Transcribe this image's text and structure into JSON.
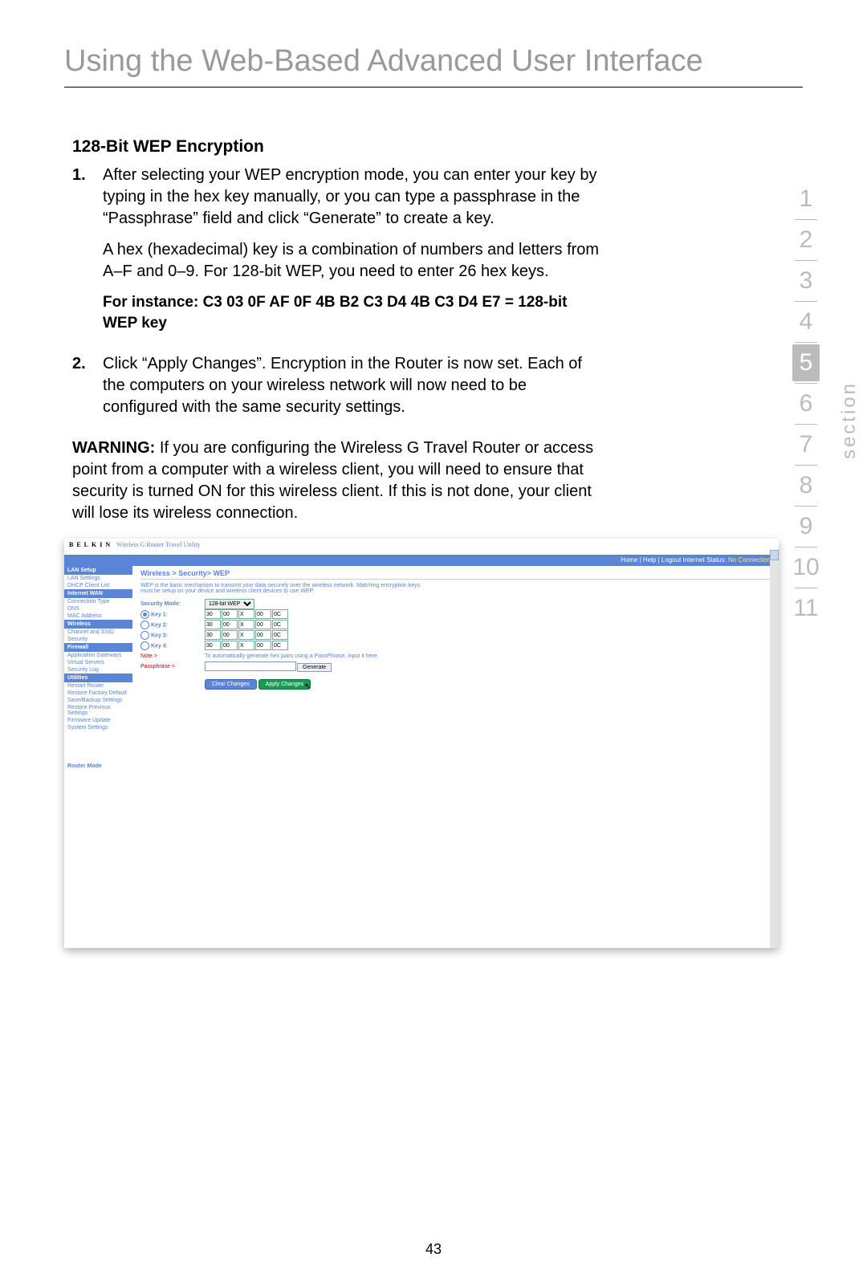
{
  "page": {
    "title": "Using the Web-Based Advanced User Interface",
    "number": "43",
    "section_label": "section"
  },
  "section_nav": {
    "items": [
      "1",
      "2",
      "3",
      "4",
      "5",
      "6",
      "7",
      "8",
      "9",
      "10",
      "11"
    ],
    "active": "5"
  },
  "body": {
    "heading": "128-Bit WEP Encryption",
    "step1_num": "1.",
    "step1_p1": "After selecting your WEP encryption mode, you can enter your key by typing in the hex key manually, or you can type a passphrase in the “Passphrase” field and click “Generate” to create a key.",
    "step1_p2": "A hex (hexadecimal) key is a combination of numbers and letters from A–F and 0–9. For 128-bit WEP, you need to enter 26 hex keys.",
    "step1_bold": "For instance:  C3 03 0F AF 0F 4B B2 C3 D4 4B C3 D4 E7 = 128-bit WEP key",
    "step2_num": "2.",
    "step2_p1": "Click “Apply Changes”. Encryption in the Router is now set. Each of the computers on your wireless network will now need to be configured with the same security settings.",
    "warning_label": "WARNING:",
    "warning_text": " If you are configuring the Wireless G Travel Router or access point from a computer with a wireless client, you will need to ensure that security is turned ON for this wireless client. If this is not done, your client will lose its wireless connection."
  },
  "shot": {
    "brand": "BELKIN",
    "brand_sub": "Wireless G Router Travel Utility",
    "bluebar_links": "Home | Help | Logout    Internet Status: ",
    "bluebar_status": "No Connection",
    "breadcrumb": "Wireless > Security> WEP",
    "desc": "WEP is the basic mechanism to transmit your data securely over the wireless network. Matching encryption keys must be setup on your device and wireless client devices to use WEP.",
    "security_mode_label": "Security Mode:",
    "security_mode_value": "128-bit WEP",
    "key_labels": [
      "Key 1:",
      "Key 2:",
      "Key 3:",
      "Key 4:"
    ],
    "key_cells": [
      "30",
      "00",
      "X",
      "00",
      "0C"
    ],
    "note_label": "Note >",
    "note_text": "To automatically generate hex pairs using a PassPhrase, input it here.",
    "passphrase_label": "Passphrase >",
    "generate_btn": "Generate",
    "clear_btn": "Clear Changes",
    "apply_btn": "Apply Changes",
    "sidebar": {
      "groups": [
        {
          "hdr": "LAN Setup",
          "items": [
            "LAN Settings",
            "DHCP Client List"
          ]
        },
        {
          "hdr": "Internet WAN",
          "items": [
            "Connection Type",
            "DNS",
            "MAC Address"
          ]
        },
        {
          "hdr": "Wireless",
          "items": [
            "Channel and SSID",
            "Security"
          ]
        },
        {
          "hdr": "Firewall",
          "items": [
            "Application Gateways",
            "Virtual Servers",
            "Security Log"
          ]
        },
        {
          "hdr": "Utilities",
          "items": [
            "Restart Router",
            "Restore Factory Default",
            "Save/Backup Settings",
            "Restore Previous Settings",
            "Firmware Update",
            "System Settings"
          ]
        }
      ],
      "router_mode": "Router Mode"
    }
  }
}
